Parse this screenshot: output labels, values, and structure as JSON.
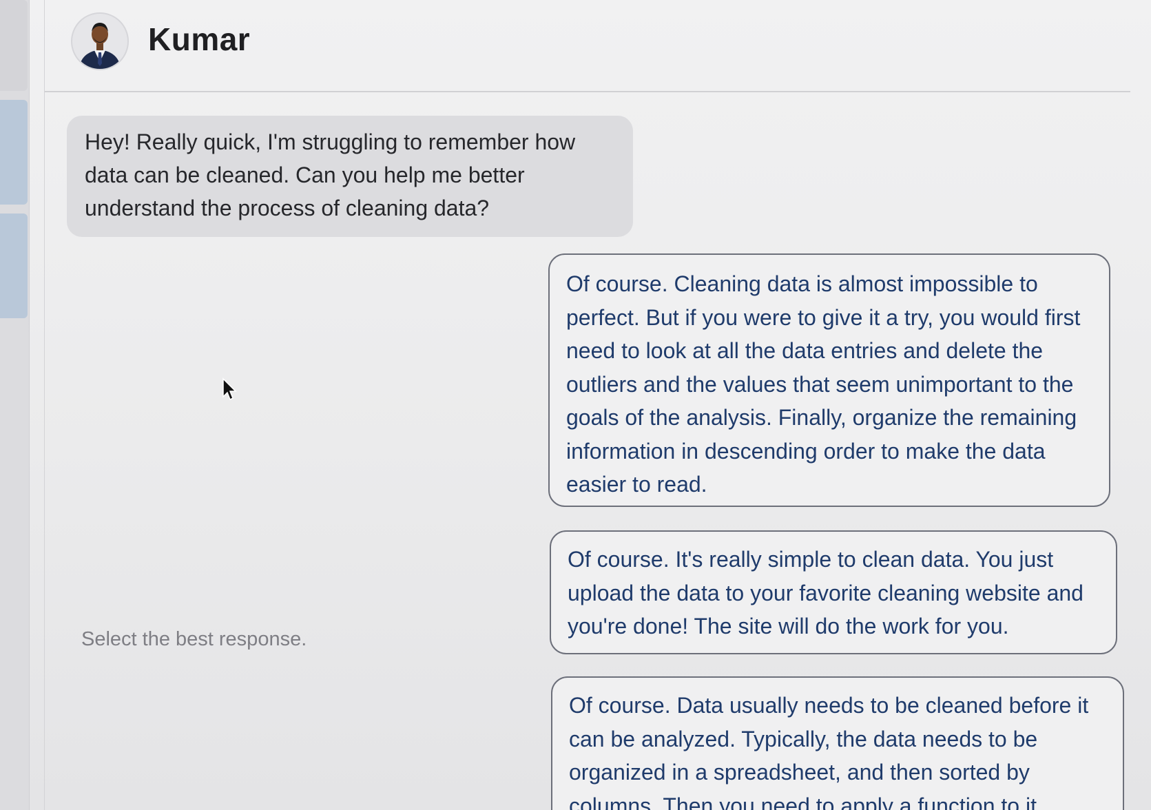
{
  "contact": {
    "name": "Kumar"
  },
  "conversation": {
    "incoming_message": "Hey! Really quick, I'm struggling to remember how data can be cleaned. Can you help me better understand the process of cleaning data?"
  },
  "prompt": {
    "label": "Select the best response."
  },
  "options": [
    {
      "text": "Of course. Cleaning data is almost impossible to perfect. But if you were to give it a try, you would first need to look at all the data entries and delete the outliers and the values that seem unimportant to the goals of the analysis. Finally, organize the remaining information in descending order to make the data easier to read."
    },
    {
      "text": "Of course. It's really simple to clean data. You just upload the data to your favorite cleaning website and you're done! The site will do the work for you."
    },
    {
      "text": "Of course. Data usually needs to be cleaned before it can be analyzed. Typically, the data needs to be organized in a spreadsheet, and then sorted by columns. Then you need to apply a function to it"
    }
  ],
  "colors": {
    "option_text": "#1f3b6b",
    "option_border": "#6c6f7a",
    "incoming_bubble": "#dcdcdf",
    "rail_accent": "#b9c8d9"
  },
  "icons": {
    "avatar": "person-avatar-icon",
    "cursor": "mouse-pointer-icon"
  }
}
